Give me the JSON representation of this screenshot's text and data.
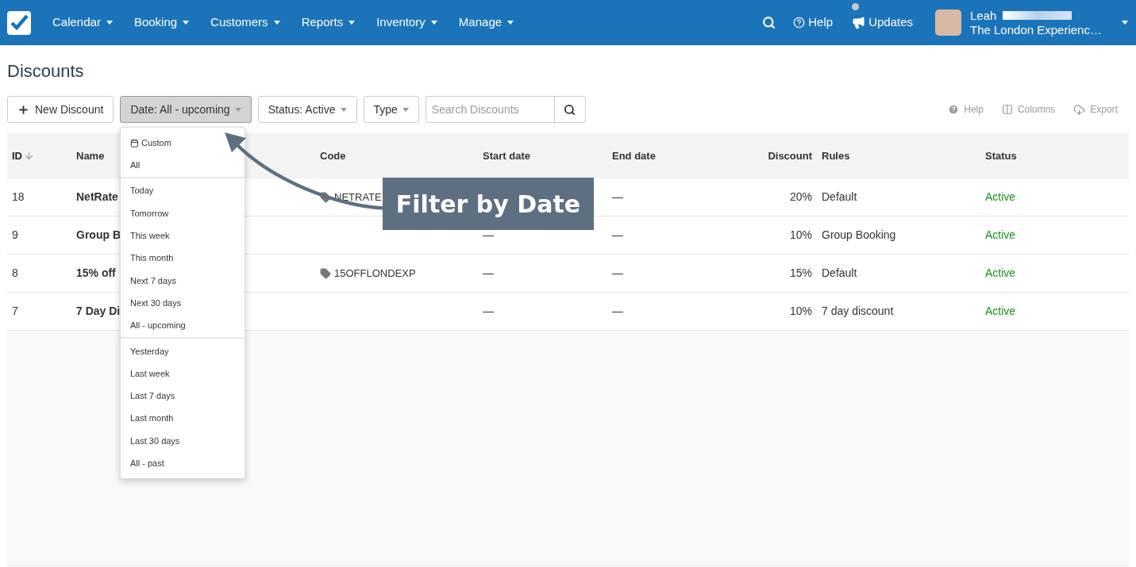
{
  "navbar": {
    "menus": [
      {
        "label": "Calendar"
      },
      {
        "label": "Booking"
      },
      {
        "label": "Customers"
      },
      {
        "label": "Reports"
      },
      {
        "label": "Inventory"
      },
      {
        "label": "Manage"
      }
    ],
    "help": "Help",
    "updates": "Updates",
    "user_name": "Leah",
    "company": "The London Experienc…"
  },
  "page_title": "Discounts",
  "toolbar": {
    "new_button": "New Discount",
    "filters": [
      {
        "label": "Date: All - upcoming",
        "open": true
      },
      {
        "label": "Status: Active",
        "open": false
      },
      {
        "label": "Type",
        "open": false
      }
    ],
    "search": {
      "placeholder": "Search Discounts"
    },
    "actions": [
      {
        "kind": "help",
        "label": "Help"
      },
      {
        "kind": "columns",
        "label": "Columns"
      },
      {
        "kind": "export",
        "label": "Export"
      }
    ]
  },
  "date_menu": {
    "groups": [
      {
        "items": [
          {
            "label": "Custom",
            "kind": "calendar"
          },
          {
            "label": "All",
            "kind": "plain"
          }
        ]
      },
      {
        "items": [
          {
            "label": "Today",
            "kind": "plain"
          },
          {
            "label": "Tomorrow",
            "kind": "plain"
          },
          {
            "label": "This week",
            "kind": "plain"
          },
          {
            "label": "This month",
            "kind": "plain"
          },
          {
            "label": "Next 7 days",
            "kind": "plain"
          },
          {
            "label": "Next 30 days",
            "kind": "plain"
          },
          {
            "label": "All - upcoming",
            "kind": "plain"
          }
        ]
      },
      {
        "items": [
          {
            "label": "Yesterday",
            "kind": "plain"
          },
          {
            "label": "Last week",
            "kind": "plain"
          },
          {
            "label": "Last 7 days",
            "kind": "plain"
          },
          {
            "label": "Last month",
            "kind": "plain"
          },
          {
            "label": "Last 30 days",
            "kind": "plain"
          },
          {
            "label": "All - past",
            "kind": "plain"
          }
        ]
      }
    ]
  },
  "table": {
    "columns": [
      {
        "label": "ID",
        "sorted": true
      },
      {
        "label": "Name",
        "sorted": false
      },
      {
        "label": "Code",
        "sorted": false
      },
      {
        "label": "Start date",
        "sorted": false
      },
      {
        "label": "End date",
        "sorted": false
      },
      {
        "label": "Discount",
        "sorted": false
      },
      {
        "label": "Rules",
        "sorted": false
      },
      {
        "label": "Status",
        "sorted": false
      }
    ],
    "rows": [
      {
        "id": "18",
        "name": "NetRate",
        "code": "NETRATE",
        "end": "—",
        "discount": "20%",
        "rules": "Default",
        "status": "Active"
      },
      {
        "id": "9",
        "name": "Group B",
        "start": "—",
        "end": "—",
        "discount": "10%",
        "rules": "Group Booking",
        "status": "Active"
      },
      {
        "id": "8",
        "name": "15% off",
        "code": "15OFFLONDEXP",
        "start": "—",
        "end": "—",
        "discount": "15%",
        "rules": "Default",
        "status": "Active"
      },
      {
        "id": "7",
        "name": "7 Day Di",
        "start": "—",
        "end": "—",
        "discount": "10%",
        "rules": "7 day discount",
        "status": "Active"
      }
    ]
  },
  "callout": {
    "text": "Filter by Date"
  }
}
